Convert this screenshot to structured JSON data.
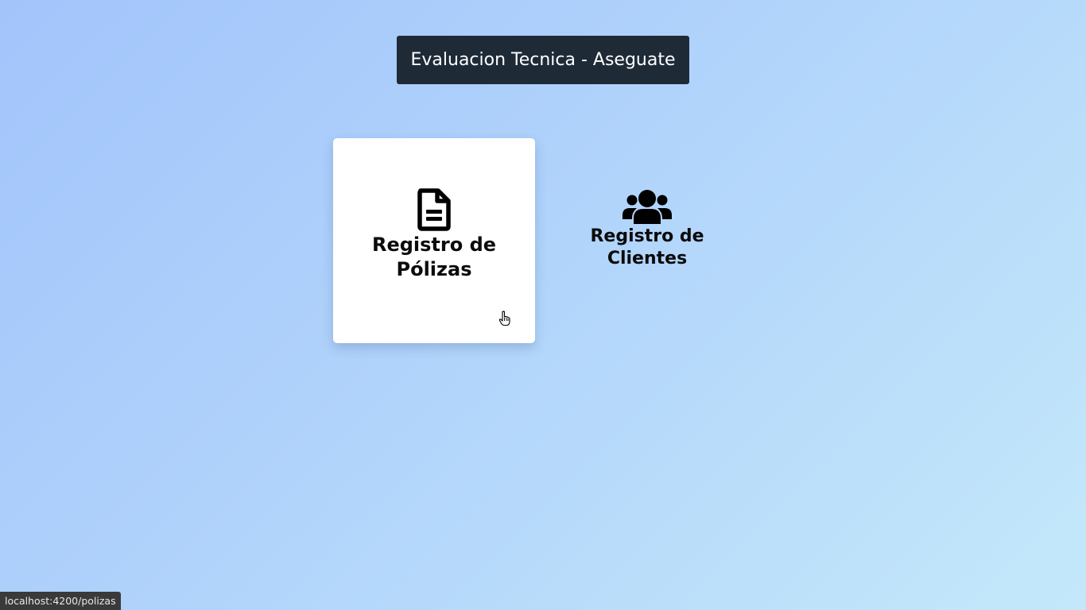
{
  "header": {
    "title": "Evaluacion Tecnica - Aseguate"
  },
  "menu": {
    "cards": [
      {
        "label": "Registro de\nPólizas",
        "icon": "file-lines-icon",
        "selected": true
      },
      {
        "label": "Registro de\nClientes",
        "icon": "users-icon",
        "selected": false
      }
    ]
  },
  "status_bar": {
    "url": "localhost:4200/polizas"
  },
  "colors": {
    "title_background": "#1f2a37",
    "card_background": "#ffffff",
    "text": "#0b0b0b",
    "background_start": "#a2c4fb",
    "background_end": "#c4e8fa"
  }
}
